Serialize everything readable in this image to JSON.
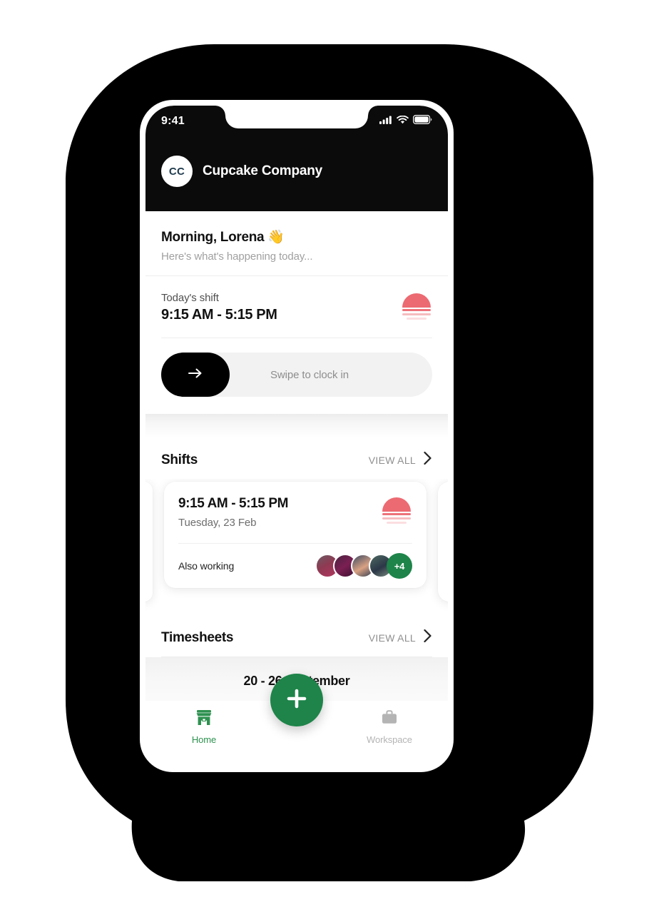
{
  "device": {
    "status_bar": {
      "time": "9:41",
      "icons": [
        "cellular-signal-icon",
        "wifi-icon",
        "battery-icon"
      ]
    }
  },
  "appbar": {
    "avatar_initials": "CC",
    "company_name": "Cupcake Company"
  },
  "greeting": {
    "title": "Morning, Lorena 👋",
    "subtitle": "Here's what's happening today..."
  },
  "today_shift": {
    "label": "Today's shift",
    "time": "9:15 AM - 5:15 PM",
    "icon": "sunrise-icon"
  },
  "clock_in": {
    "track_label": "Swipe to clock in",
    "knob_icon": "arrow-right-icon"
  },
  "shifts_section": {
    "title": "Shifts",
    "view_all_label": "VIEW ALL",
    "chevron_icon": "chevron-right-icon",
    "cards": [
      {
        "time": "9:15 AM - 5:15 PM",
        "date": "Tuesday, 23 Feb",
        "icon": "sunrise-icon",
        "also_working_label": "Also working",
        "avatar_count_overflow": "+4",
        "avatars": [
          "avatar-1",
          "avatar-2",
          "avatar-3",
          "avatar-4"
        ]
      }
    ]
  },
  "timesheets_section": {
    "title": "Timesheets",
    "view_all_label": "VIEW ALL",
    "chevron_icon": "chevron-right-icon",
    "period": "20 - 26 September"
  },
  "fab": {
    "icon": "plus-icon"
  },
  "bottom_nav": {
    "items": [
      {
        "label": "Home",
        "icon": "store-icon",
        "active": true
      },
      {
        "label": "Workspace",
        "icon": "briefcase-icon",
        "active": false
      }
    ]
  },
  "colors": {
    "brand_green": "#1e8449",
    "nav_active_green": "#2e9150",
    "sunrise_coral": "#ec6a72",
    "appbar_black": "#0b0b0b",
    "avatar_initials": "#1f3b4d",
    "muted_text": "#a0a0a0"
  }
}
